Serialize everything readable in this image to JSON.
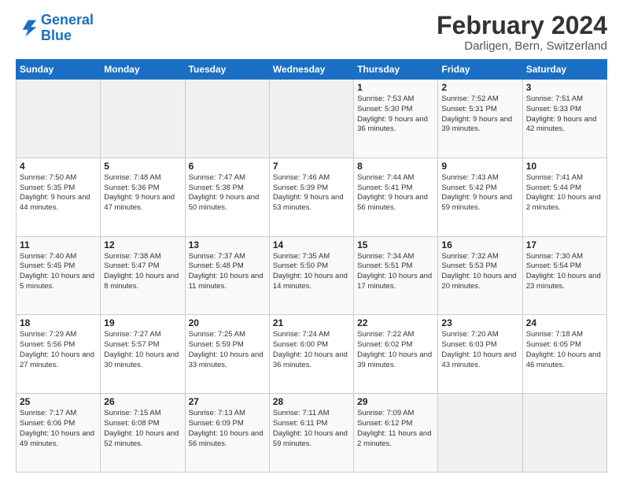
{
  "logo": {
    "line1": "General",
    "line2": "Blue"
  },
  "title": "February 2024",
  "location": "Darligen, Bern, Switzerland",
  "days_of_week": [
    "Sunday",
    "Monday",
    "Tuesday",
    "Wednesday",
    "Thursday",
    "Friday",
    "Saturday"
  ],
  "weeks": [
    [
      {
        "day": "",
        "info": ""
      },
      {
        "day": "",
        "info": ""
      },
      {
        "day": "",
        "info": ""
      },
      {
        "day": "",
        "info": ""
      },
      {
        "day": "1",
        "info": "Sunrise: 7:53 AM\nSunset: 5:30 PM\nDaylight: 9 hours and 36 minutes."
      },
      {
        "day": "2",
        "info": "Sunrise: 7:52 AM\nSunset: 5:31 PM\nDaylight: 9 hours and 39 minutes."
      },
      {
        "day": "3",
        "info": "Sunrise: 7:51 AM\nSunset: 5:33 PM\nDaylight: 9 hours and 42 minutes."
      }
    ],
    [
      {
        "day": "4",
        "info": "Sunrise: 7:50 AM\nSunset: 5:35 PM\nDaylight: 9 hours and 44 minutes."
      },
      {
        "day": "5",
        "info": "Sunrise: 7:48 AM\nSunset: 5:36 PM\nDaylight: 9 hours and 47 minutes."
      },
      {
        "day": "6",
        "info": "Sunrise: 7:47 AM\nSunset: 5:38 PM\nDaylight: 9 hours and 50 minutes."
      },
      {
        "day": "7",
        "info": "Sunrise: 7:46 AM\nSunset: 5:39 PM\nDaylight: 9 hours and 53 minutes."
      },
      {
        "day": "8",
        "info": "Sunrise: 7:44 AM\nSunset: 5:41 PM\nDaylight: 9 hours and 56 minutes."
      },
      {
        "day": "9",
        "info": "Sunrise: 7:43 AM\nSunset: 5:42 PM\nDaylight: 9 hours and 59 minutes."
      },
      {
        "day": "10",
        "info": "Sunrise: 7:41 AM\nSunset: 5:44 PM\nDaylight: 10 hours and 2 minutes."
      }
    ],
    [
      {
        "day": "11",
        "info": "Sunrise: 7:40 AM\nSunset: 5:45 PM\nDaylight: 10 hours and 5 minutes."
      },
      {
        "day": "12",
        "info": "Sunrise: 7:38 AM\nSunset: 5:47 PM\nDaylight: 10 hours and 8 minutes."
      },
      {
        "day": "13",
        "info": "Sunrise: 7:37 AM\nSunset: 5:48 PM\nDaylight: 10 hours and 11 minutes."
      },
      {
        "day": "14",
        "info": "Sunrise: 7:35 AM\nSunset: 5:50 PM\nDaylight: 10 hours and 14 minutes."
      },
      {
        "day": "15",
        "info": "Sunrise: 7:34 AM\nSunset: 5:51 PM\nDaylight: 10 hours and 17 minutes."
      },
      {
        "day": "16",
        "info": "Sunrise: 7:32 AM\nSunset: 5:53 PM\nDaylight: 10 hours and 20 minutes."
      },
      {
        "day": "17",
        "info": "Sunrise: 7:30 AM\nSunset: 5:54 PM\nDaylight: 10 hours and 23 minutes."
      }
    ],
    [
      {
        "day": "18",
        "info": "Sunrise: 7:29 AM\nSunset: 5:56 PM\nDaylight: 10 hours and 27 minutes."
      },
      {
        "day": "19",
        "info": "Sunrise: 7:27 AM\nSunset: 5:57 PM\nDaylight: 10 hours and 30 minutes."
      },
      {
        "day": "20",
        "info": "Sunrise: 7:25 AM\nSunset: 5:59 PM\nDaylight: 10 hours and 33 minutes."
      },
      {
        "day": "21",
        "info": "Sunrise: 7:24 AM\nSunset: 6:00 PM\nDaylight: 10 hours and 36 minutes."
      },
      {
        "day": "22",
        "info": "Sunrise: 7:22 AM\nSunset: 6:02 PM\nDaylight: 10 hours and 39 minutes."
      },
      {
        "day": "23",
        "info": "Sunrise: 7:20 AM\nSunset: 6:03 PM\nDaylight: 10 hours and 43 minutes."
      },
      {
        "day": "24",
        "info": "Sunrise: 7:18 AM\nSunset: 6:05 PM\nDaylight: 10 hours and 46 minutes."
      }
    ],
    [
      {
        "day": "25",
        "info": "Sunrise: 7:17 AM\nSunset: 6:06 PM\nDaylight: 10 hours and 49 minutes."
      },
      {
        "day": "26",
        "info": "Sunrise: 7:15 AM\nSunset: 6:08 PM\nDaylight: 10 hours and 52 minutes."
      },
      {
        "day": "27",
        "info": "Sunrise: 7:13 AM\nSunset: 6:09 PM\nDaylight: 10 hours and 56 minutes."
      },
      {
        "day": "28",
        "info": "Sunrise: 7:11 AM\nSunset: 6:11 PM\nDaylight: 10 hours and 59 minutes."
      },
      {
        "day": "29",
        "info": "Sunrise: 7:09 AM\nSunset: 6:12 PM\nDaylight: 11 hours and 2 minutes."
      },
      {
        "day": "",
        "info": ""
      },
      {
        "day": "",
        "info": ""
      }
    ]
  ]
}
